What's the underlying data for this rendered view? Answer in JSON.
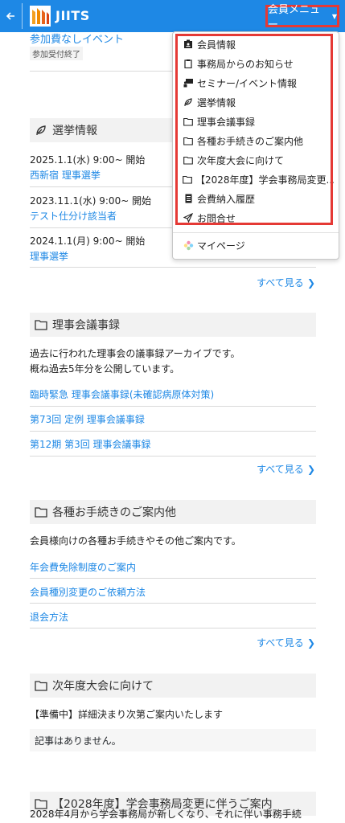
{
  "header": {
    "title": "JIITS",
    "menu_label": "会員メニュー"
  },
  "top_event": {
    "title": "参加費なしイベント",
    "badge": "参加受付終了"
  },
  "election": {
    "heading": "選挙情報",
    "items": [
      {
        "date": "2025.1.1(水) 9:00~ 開始",
        "title": "西新宿 理事選挙"
      },
      {
        "date": "2023.11.1(水) 9:00~ 開始",
        "title": "テスト仕分け該当者"
      },
      {
        "date": "2024.1.1(月) 9:00~ 開始",
        "title": "理事選挙"
      }
    ],
    "see_all": "すべて見る"
  },
  "board": {
    "heading": "理事会議事録",
    "desc1": "過去に行われた理事会の議事録アーカイブです。",
    "desc2": "概ね過去5年分を公開しています。",
    "links": [
      "臨時緊急 理事会議事録(未確認病原体対策)",
      "第73回 定例 理事会議事録",
      "第12期 第3回 理事会議事録"
    ],
    "see_all": "すべて見る"
  },
  "procedures": {
    "heading": "各種お手続きのご案内他",
    "desc": "会員様向けの各種お手続きやその他ご案内です。",
    "links": [
      "年会費免除制度のご案内",
      "会員種別変更のご依頼方法",
      "退会方法"
    ],
    "see_all": "すべて見る"
  },
  "next_conf": {
    "heading": "次年度大会に向けて",
    "line1": "【準備中】詳細決まり次第ご案内いたします",
    "line2": "記事はありません。"
  },
  "office": {
    "heading": "【2028年度】学会事務局変更に伴うご案内",
    "desc": "2028年4月から学会事務局が新しくなり、それに伴い事務手続"
  },
  "dropdown": {
    "items": [
      {
        "label": "会員情報",
        "icon": "id-card-icon"
      },
      {
        "label": "事務局からのお知らせ",
        "icon": "clipboard-icon"
      },
      {
        "label": "セミナー/イベント情報",
        "icon": "presentation-icon"
      },
      {
        "label": "選挙情報",
        "icon": "seedling-icon"
      },
      {
        "label": "理事会議事録",
        "icon": "folder-icon"
      },
      {
        "label": "各種お手続きのご案内他",
        "icon": "folder-icon"
      },
      {
        "label": "次年度大会に向けて",
        "icon": "folder-icon"
      },
      {
        "label": "【2028年度】学会事務局変更...",
        "icon": "folder-icon"
      },
      {
        "label": "会費納入履歴",
        "icon": "document-icon"
      },
      {
        "label": "お問合せ",
        "icon": "paper-plane-icon"
      }
    ],
    "mypage": {
      "label": "マイページ",
      "icon": "flower-icon"
    }
  },
  "colors": {
    "primary": "#1e88e5",
    "highlight": "#e53935"
  }
}
